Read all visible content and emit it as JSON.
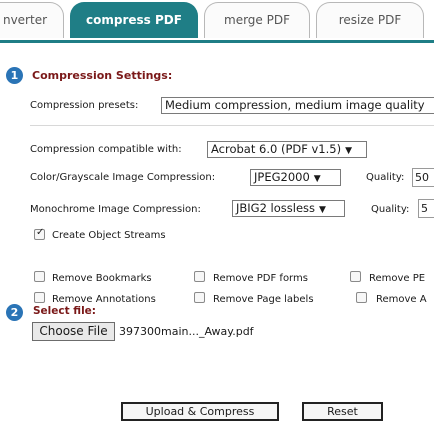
{
  "tabs": [
    {
      "label": "nverter"
    },
    {
      "label": "compress PDF"
    },
    {
      "label": "merge PDF"
    },
    {
      "label": "resize PDF"
    }
  ],
  "section1": {
    "number": "1",
    "title": "Compression Settings:",
    "presets_label": "Compression presets:",
    "presets_value": "Medium compression, medium image quality",
    "compat_label": "Compression compatible with:",
    "compat_value": "Acrobat 6.0 (PDF v1.5)",
    "color_label": "Color/Grayscale Image Compression:",
    "color_value": "JPEG2000",
    "color_quality_label": "Quality:",
    "color_quality_value": "50",
    "mono_label": "Monochrome Image Compression:",
    "mono_value": "JBIG2 lossless",
    "mono_quality_label": "Quality:",
    "mono_quality_value": "5",
    "object_streams_label": "Create Object Streams",
    "options": {
      "remove_bookmarks": "Remove Bookmarks",
      "remove_pdf_forms": "Remove PDF forms",
      "remove_pe": "Remove PE",
      "remove_annotations": "Remove Annotations",
      "remove_page_labels": "Remove Page labels",
      "remove_a": "Remove A"
    }
  },
  "section2": {
    "number": "2",
    "title": "Select file:",
    "choose_file_label": "Choose File",
    "file_name": "397300main..._Away.pdf"
  },
  "actions": {
    "upload_label": "Upload & Compress",
    "reset_label": "Reset"
  }
}
